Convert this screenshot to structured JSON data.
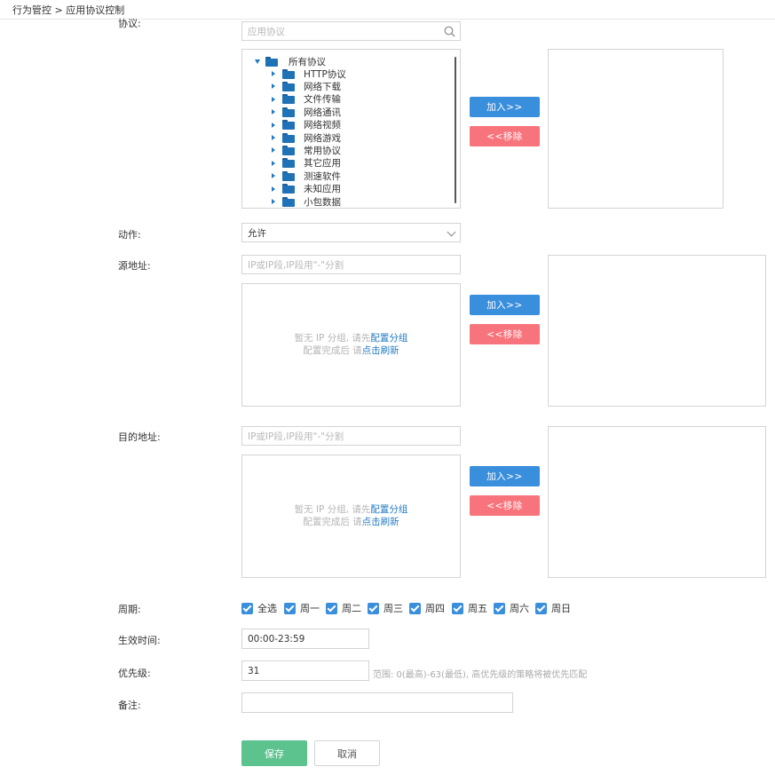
{
  "breadcrumb": "行为管控 > 应用协议控制",
  "protocol": {
    "label": "协议:",
    "search_placeholder": "应用协议",
    "root": "所有协议",
    "items": [
      "HTTP协议",
      "网络下载",
      "文件传输",
      "网络通讯",
      "网络视频",
      "网络游戏",
      "常用协议",
      "其它应用",
      "测速软件",
      "未知应用",
      "小包数据"
    ],
    "add_label": "加入>>",
    "remove_label": "<<移除"
  },
  "action": {
    "label": "动作:",
    "value": "允许"
  },
  "source": {
    "label": "源地址:",
    "placeholder": "IP或IP段,IP段用\"-\"分割",
    "empty_line1_prefix": "暂无 IP 分组, 请先",
    "empty_line1_link": "配置分组",
    "empty_line2_prefix": "配置完成后 请",
    "empty_line2_link": "点击刷新",
    "add_label": "加入>>",
    "remove_label": "<<移除"
  },
  "destination": {
    "label": "目的地址:",
    "placeholder": "IP或IP段,IP段用\"-\"分割",
    "empty_line1_prefix": "暂无 IP 分组, 请先",
    "empty_line1_link": "配置分组",
    "empty_line2_prefix": "配置完成后 请",
    "empty_line2_link": "点击刷新",
    "add_label": "加入>>",
    "remove_label": "<<移除"
  },
  "period": {
    "label": "周期:",
    "options": [
      {
        "label": "全选",
        "checked": true
      },
      {
        "label": "周一",
        "checked": true
      },
      {
        "label": "周二",
        "checked": true
      },
      {
        "label": "周三",
        "checked": true
      },
      {
        "label": "周四",
        "checked": true
      },
      {
        "label": "周五",
        "checked": true
      },
      {
        "label": "周六",
        "checked": true
      },
      {
        "label": "周日",
        "checked": true
      }
    ]
  },
  "effective_time": {
    "label": "生效时间:",
    "value": "00:00-23:59"
  },
  "priority": {
    "label": "优先级:",
    "value": "31",
    "hint": "范围: 0(最高)-63(最低), 高优先级的策略将被优先匹配"
  },
  "remark": {
    "label": "备注:",
    "value": ""
  },
  "buttons": {
    "save": "保存",
    "cancel": "取消"
  },
  "colors": {
    "primary": "#3a8fdd",
    "danger": "#f8747c",
    "success": "#5cc38f",
    "link": "#1f7ac3"
  },
  "icons": {
    "search": "search-icon",
    "folder": "folder-icon",
    "expand": "caret-right-icon",
    "collapse": "caret-down-icon",
    "dropdown": "chevron-down-icon",
    "check": "checkbox-checked-icon"
  }
}
